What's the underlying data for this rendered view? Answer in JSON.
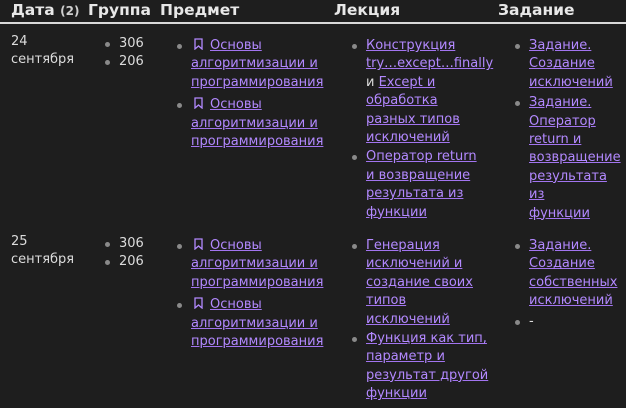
{
  "header": {
    "date": "Дата",
    "date_count": "(2)",
    "group": "Группа",
    "subject": "Предмет",
    "lecture": "Лекция",
    "task": "Задание"
  },
  "rows": [
    {
      "day": "24",
      "month": "сентября",
      "groups": [
        "306",
        "206"
      ],
      "subjects": [
        {
          "line1": "Основы",
          "line2": "алгоритмизации и",
          "line3": "программирования"
        },
        {
          "line1": "Основы",
          "line2": "алгоритмизации и",
          "line3": "программирования"
        }
      ],
      "lectures": {
        "l1": "Конструкция",
        "l2": "try…except…finally",
        "and": "и",
        "l3": "Except и",
        "l4": "обработка",
        "l5": "разных типов",
        "l6": "исключений",
        "l7": "Оператор return",
        "l8": "и возвращение",
        "l9": "результата из",
        "l10": "функции"
      },
      "tasks": {
        "t1": "Задание.",
        "t2": "Создание",
        "t3": "исключений",
        "t4": "Задание.",
        "t5": "Оператор",
        "t6": "return и",
        "t7": "возвращение",
        "t8": "результата из",
        "t9": "функции"
      }
    },
    {
      "day": "25",
      "month": "сентября",
      "groups": [
        "306",
        "206"
      ],
      "subjects": [
        {
          "line1": "Основы",
          "line2": "алгоритмизации и",
          "line3": "программирования"
        },
        {
          "line1": "Основы",
          "line2": "алгоритмизации и",
          "line3": "программирования"
        }
      ],
      "lectures": {
        "l1": "Генерация",
        "l2": "исключений и",
        "l3": "создание своих",
        "l4": "типов",
        "l5": "исключений",
        "l6": "Функция как тип,",
        "l7": "параметр и",
        "l8": "результат другой",
        "l9": "функции"
      },
      "tasks": {
        "t1": "Задание.",
        "t2": "Создание",
        "t3": "собственных",
        "t4": "исключений",
        "t5": "-"
      }
    }
  ],
  "colors": {
    "link": "#b389ff",
    "background": "#1e1e1e",
    "bookmark_icon": "#b389ff"
  }
}
